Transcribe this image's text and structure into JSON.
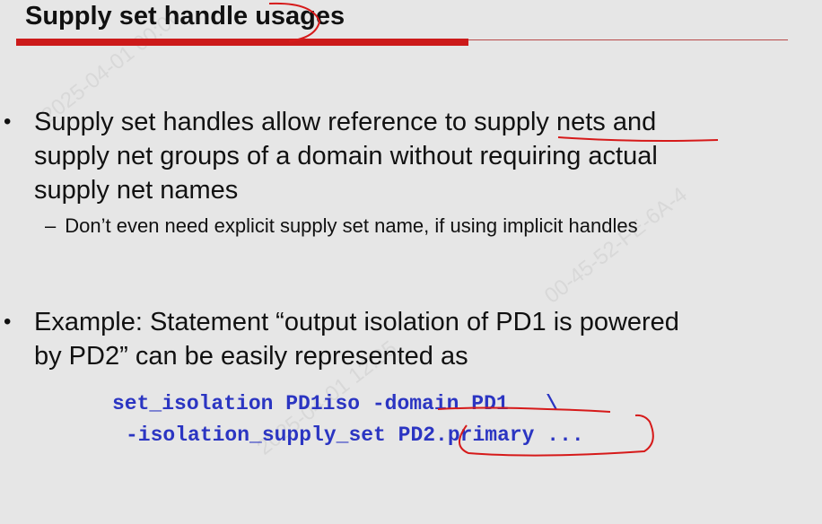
{
  "slide": {
    "title": "Supply set handle usages",
    "bullets": [
      {
        "lines": [
          "Supply set handles allow reference to supply nets and",
          "supply net groups of a domain without requiring actual",
          "supply net names"
        ],
        "sub": "Don’t even need explicit supply set name, if using implicit handles"
      },
      {
        "lines": [
          "Example:  Statement “output isolation of PD1 is powered",
          "by PD2” can be easily represented as"
        ]
      }
    ],
    "code": {
      "line1": "set_isolation PD1iso -domain PD1   \\",
      "line2": "-isolation_supply_set PD2.primary ..."
    },
    "bullet_char": "•",
    "sub_dash": "–"
  },
  "colors": {
    "title_bar": "#cc1a1a",
    "code": "#2b35c2",
    "annotation": "#d61a1a",
    "background": "#e6e6e6"
  }
}
